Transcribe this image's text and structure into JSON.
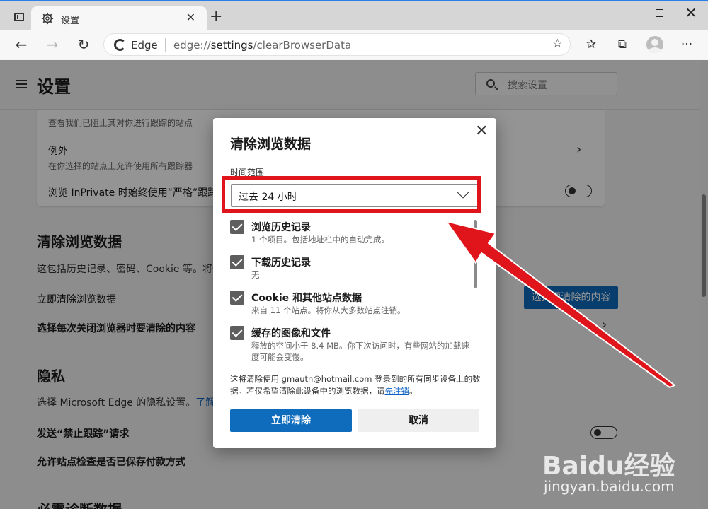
{
  "browser": {
    "tab_title": "设置",
    "tab_close": "✕",
    "new_tab": "+",
    "brand": "Edge",
    "url_prefix": "edge://",
    "url_host": "settings",
    "url_path": "/clearBrowserData"
  },
  "page": {
    "title": "设置",
    "search_placeholder": "搜索设置",
    "card": {
      "top_desc": "查看我们已阻止其对你进行跟踪的站点",
      "exceptions_title": "例外",
      "exceptions_desc": "在你选择的站点上允许使用所有跟踪器",
      "inprivate_label": "浏览 InPrivate 时始终使用“严格”跟踪"
    },
    "clear_section": {
      "title": "清除浏览数据",
      "desc": "这包括历史记录、密码、Cookie 等。将仅",
      "clear_now": "立即清除浏览数据",
      "choose_button": "选择要清除的内容",
      "on_close": "选择每次关闭浏览器时要清除的内容"
    },
    "privacy_section": {
      "title": "隐私",
      "desc": "选择 Microsoft Edge 的隐私设置。",
      "learn_more": "了解",
      "dnt": "发送“禁止跟踪”请求",
      "payment": "允许站点检查是否已保存付款方式"
    },
    "diag_title": "必需诊断数据"
  },
  "dialog": {
    "title": "清除浏览数据",
    "close": "✕",
    "range_label": "时间范围",
    "range_value": "过去 24 小时",
    "items": [
      {
        "title": "浏览历史记录",
        "desc": "1 个项目。包括地址栏中的自动完成。",
        "checked": true
      },
      {
        "title": "下载历史记录",
        "desc": "无",
        "checked": true
      },
      {
        "title": "Cookie 和其他站点数据",
        "desc": "来自 11 个站点。将你从大多数站点注销。",
        "checked": true
      },
      {
        "title": "缓存的图像和文件",
        "desc": "释放的空间小于 8.4 MB。你下次访问时，有些网站的加载速度可能会变慢。",
        "checked": true
      }
    ],
    "sync_note": "这将清除使用 gmautn@hotmail.com 登录到的所有同步设备上的数据。若仅希望清除此设备中的浏览数据，请",
    "sync_link": "先注销",
    "sync_end": "。",
    "clear_button": "立即清除",
    "cancel_button": "取消"
  },
  "watermark": {
    "logo": "Baidu经验",
    "sub": "jingyan.baidu.com"
  },
  "colors": {
    "accent": "#0f6cbd",
    "highlight": "#e0141b"
  }
}
